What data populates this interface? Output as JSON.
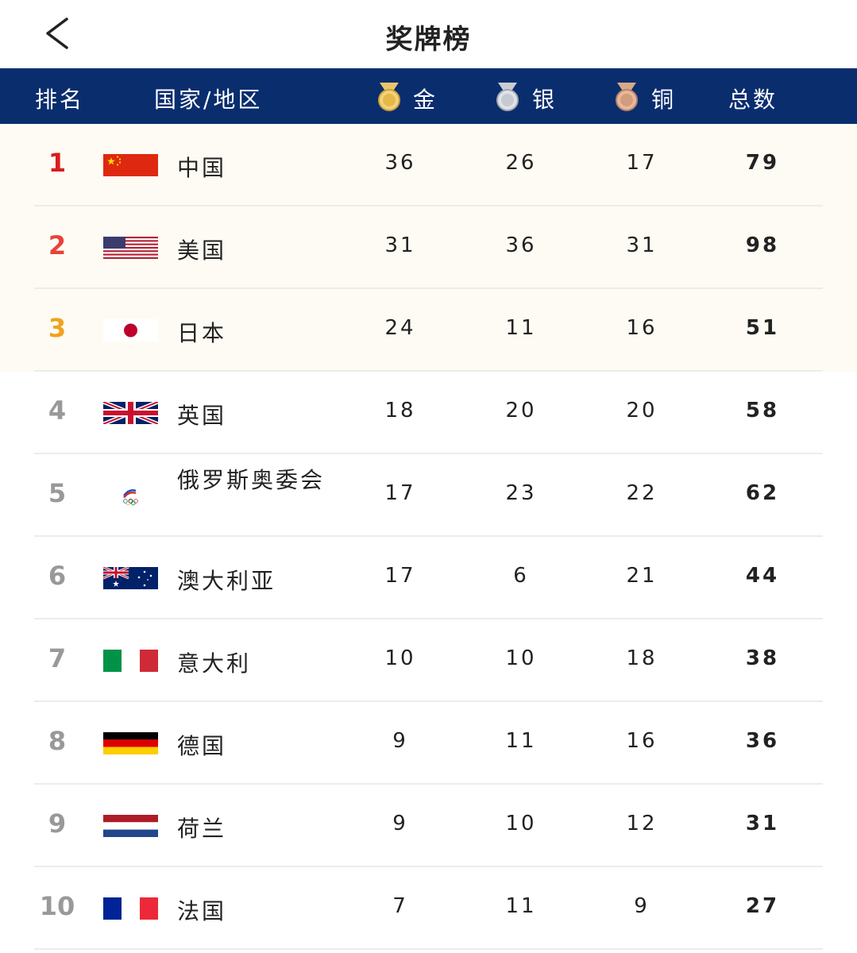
{
  "page": {
    "title": "奖牌榜"
  },
  "icons": {
    "back": "back-arrow-icon"
  },
  "colors": {
    "header_bg": "#0a2d6e",
    "rank_1": "#d81e1e",
    "rank_2": "#e8423a",
    "rank_3": "#f2a21c",
    "rank_other": "#999999",
    "top3_row_bg": "#fdfbf3"
  },
  "header": {
    "rank": "排名",
    "country": "国家/地区",
    "gold": "金",
    "silver": "银",
    "bronze": "铜",
    "total": "总数"
  },
  "rows": [
    {
      "rank": "1",
      "flag": "china-flag-icon",
      "name": "中国",
      "gold": "36",
      "silver": "26",
      "bronze": "17",
      "total": "79"
    },
    {
      "rank": "2",
      "flag": "usa-flag-icon",
      "name": "美国",
      "gold": "31",
      "silver": "36",
      "bronze": "31",
      "total": "98"
    },
    {
      "rank": "3",
      "flag": "japan-flag-icon",
      "name": "日本",
      "gold": "24",
      "silver": "11",
      "bronze": "16",
      "total": "51"
    },
    {
      "rank": "4",
      "flag": "uk-flag-icon",
      "name": "英国",
      "gold": "18",
      "silver": "20",
      "bronze": "20",
      "total": "58"
    },
    {
      "rank": "5",
      "flag": "roc-emblem-icon",
      "name": "俄罗斯奥委会",
      "gold": "17",
      "silver": "23",
      "bronze": "22",
      "total": "62"
    },
    {
      "rank": "6",
      "flag": "australia-flag-icon",
      "name": "澳大利亚",
      "gold": "17",
      "silver": "6",
      "bronze": "21",
      "total": "44"
    },
    {
      "rank": "7",
      "flag": "italy-flag-icon",
      "name": "意大利",
      "gold": "10",
      "silver": "10",
      "bronze": "18",
      "total": "38"
    },
    {
      "rank": "8",
      "flag": "germany-flag-icon",
      "name": "德国",
      "gold": "9",
      "silver": "11",
      "bronze": "16",
      "total": "36"
    },
    {
      "rank": "9",
      "flag": "netherlands-flag-icon",
      "name": "荷兰",
      "gold": "9",
      "silver": "10",
      "bronze": "12",
      "total": "31"
    },
    {
      "rank": "10",
      "flag": "france-flag-icon",
      "name": "法国",
      "gold": "7",
      "silver": "11",
      "bronze": "9",
      "total": "27"
    }
  ]
}
